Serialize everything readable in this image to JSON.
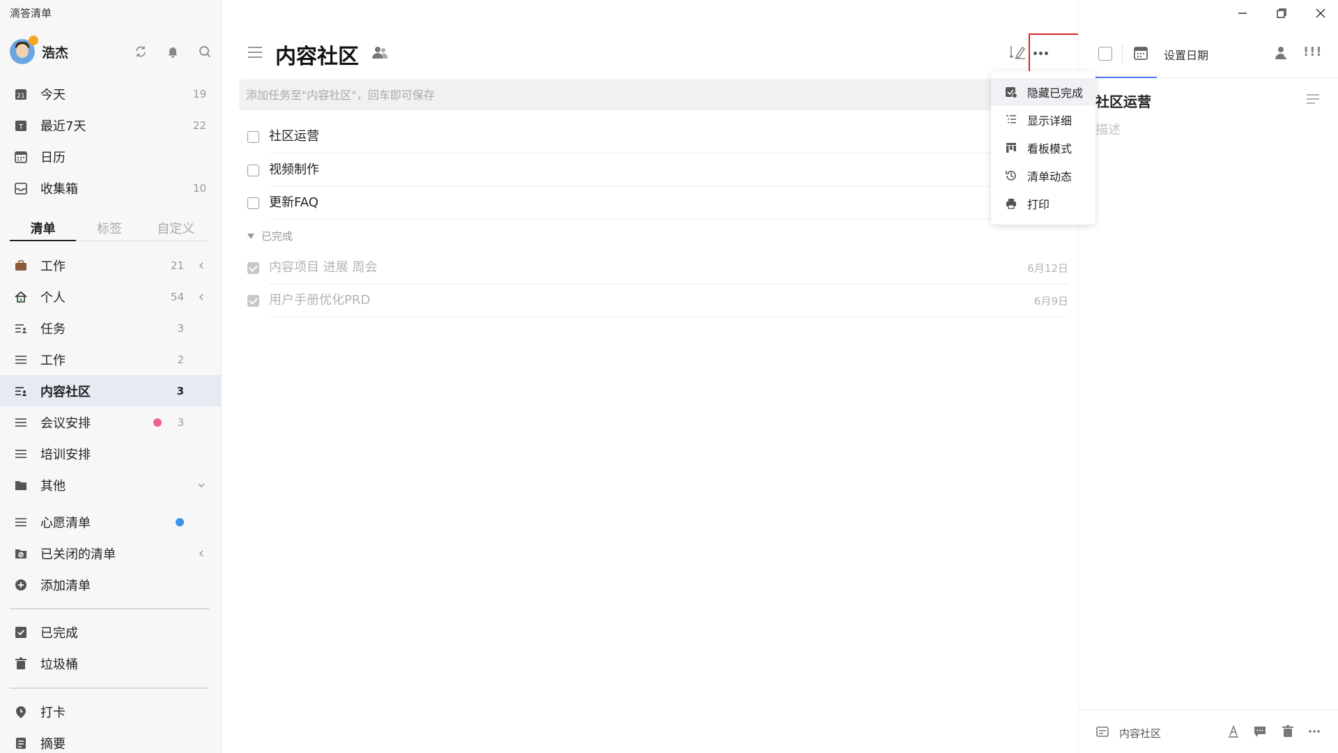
{
  "app": {
    "title": "滴答清单"
  },
  "user": {
    "name": "浩杰"
  },
  "smart_lists": [
    {
      "label": "今天",
      "count": "19"
    },
    {
      "label": "最近7天",
      "count": "22"
    },
    {
      "label": "日历",
      "count": ""
    },
    {
      "label": "收集箱",
      "count": "10"
    }
  ],
  "tabs": [
    "清单",
    "标签",
    "自定义"
  ],
  "lists": [
    {
      "label": "工作",
      "count": "21"
    },
    {
      "label": "个人",
      "count": "54"
    },
    {
      "label": "任务",
      "count": "3"
    },
    {
      "label": "工作",
      "count": "2"
    },
    {
      "label": "内容社区",
      "count": "3"
    },
    {
      "label": "会议安排",
      "count": "3"
    },
    {
      "label": "培训安排",
      "count": ""
    },
    {
      "label": "其他",
      "count": ""
    },
    {
      "label": "心愿清单",
      "count": ""
    },
    {
      "label": "已关闭的清单",
      "count": ""
    },
    {
      "label": "添加清单",
      "count": ""
    }
  ],
  "bottom_nav": [
    {
      "label": "已完成"
    },
    {
      "label": "垃圾桶"
    },
    {
      "label": "打卡"
    },
    {
      "label": "摘要"
    }
  ],
  "colors": {
    "accent": "#4772fa",
    "meeting_dot": "#f06292",
    "wish_dot": "#3a96e8",
    "highlight": "#e02020"
  },
  "main": {
    "title": "内容社区",
    "add_placeholder": "添加任务至\"内容社区\"，回车即可保存",
    "tasks": [
      {
        "title": "社区运营"
      },
      {
        "title": "视频制作"
      },
      {
        "title": "更新FAQ"
      }
    ],
    "completed_label": "已完成",
    "completed_tasks": [
      {
        "title": "内容项目 进展 周会",
        "date": "6月12日"
      },
      {
        "title": "用户手册优化PRD",
        "date": "6月9日"
      }
    ]
  },
  "more_menu": {
    "items": [
      {
        "label": "隐藏已完成",
        "icon": "hide-completed-icon"
      },
      {
        "label": "显示详细",
        "icon": "show-details-icon"
      },
      {
        "label": "看板模式",
        "icon": "kanban-icon"
      },
      {
        "label": "清单动态",
        "icon": "activity-icon"
      },
      {
        "label": "打印",
        "icon": "print-icon"
      }
    ]
  },
  "detail": {
    "date_label": "设置日期",
    "priority": "!!!",
    "title": "社区运营",
    "desc_placeholder": "描述",
    "list_name": "内容社区"
  }
}
